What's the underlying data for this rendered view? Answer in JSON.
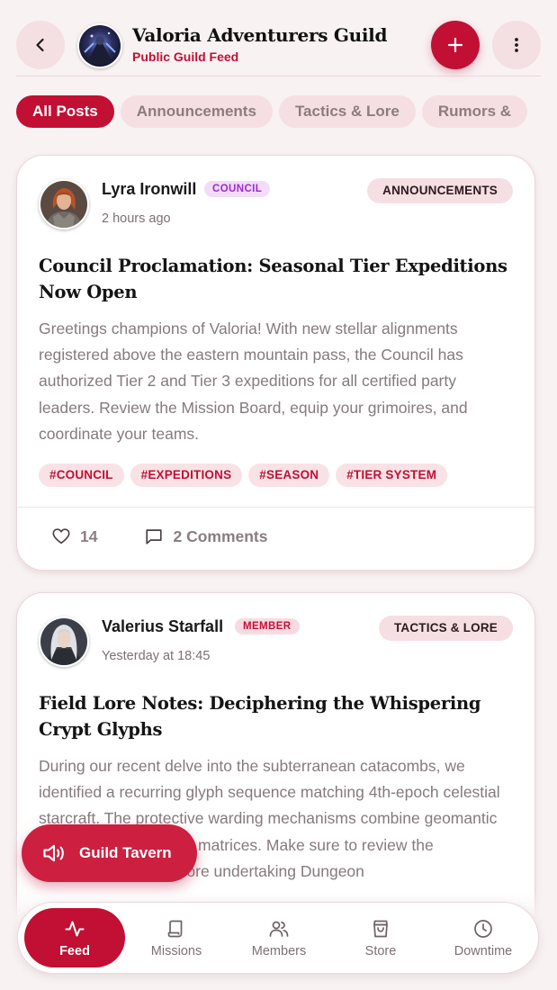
{
  "header": {
    "title": "Valoria Adventurers Guild",
    "subtitle": "Public Guild Feed",
    "back_icon": "chevron-left-icon",
    "add_icon": "plus-icon",
    "more_icon": "more-vertical-icon"
  },
  "filters": [
    {
      "label": "All Posts",
      "active": true
    },
    {
      "label": "Announcements",
      "active": false
    },
    {
      "label": "Tactics & Lore",
      "active": false
    },
    {
      "label": "Rumors &",
      "active": false
    }
  ],
  "posts": [
    {
      "author": "Lyra Ironwill",
      "role": "COUNCIL",
      "time": "2 hours ago",
      "category": "ANNOUNCEMENTS",
      "title": "Council Proclamation: Seasonal Tier Expeditions Now Open",
      "body": "Greetings champions of Valoria! With new stellar alignments registered above the eastern mountain pass, the Council has authorized Tier 2 and Tier 3 expeditions for all certified party leaders. Review the Mission Board, equip your grimoires, and coordinate your teams.",
      "tags": [
        "#COUNCIL",
        "#EXPEDITIONS",
        "#SEASON",
        "#TIER SYSTEM"
      ],
      "likes": "14",
      "comments": "2 Comments"
    },
    {
      "author": "Valerius Starfall",
      "role": "MEMBER",
      "time": "Yesterday at 18:45",
      "category": "TACTICS & LORE",
      "title": "Field Lore Notes: Deciphering the Whispering Crypt Glyphs",
      "body": "During our recent delve into the subterranean catacombs, we identified a recurring glyph sequence matching 4th-epoch celestial starcraft. The protective warding mechanisms combine geomantic force and radiant spell matrices. Make sure to review the illumination cards before undertaking Dungeon"
    }
  ],
  "tavern": {
    "label": "Guild Tavern",
    "icon": "speaker-icon"
  },
  "nav": [
    {
      "label": "Feed",
      "icon": "activity-icon",
      "active": true
    },
    {
      "label": "Missions",
      "icon": "scroll-icon",
      "active": false
    },
    {
      "label": "Members",
      "icon": "users-icon",
      "active": false
    },
    {
      "label": "Store",
      "icon": "bag-icon",
      "active": false
    },
    {
      "label": "Downtime",
      "icon": "clock-icon",
      "active": false
    }
  ],
  "colors": {
    "accent": "#c20f34",
    "background": "#f8f2f3",
    "chip": "#f6dfe3",
    "council": "#9b2bcf"
  }
}
